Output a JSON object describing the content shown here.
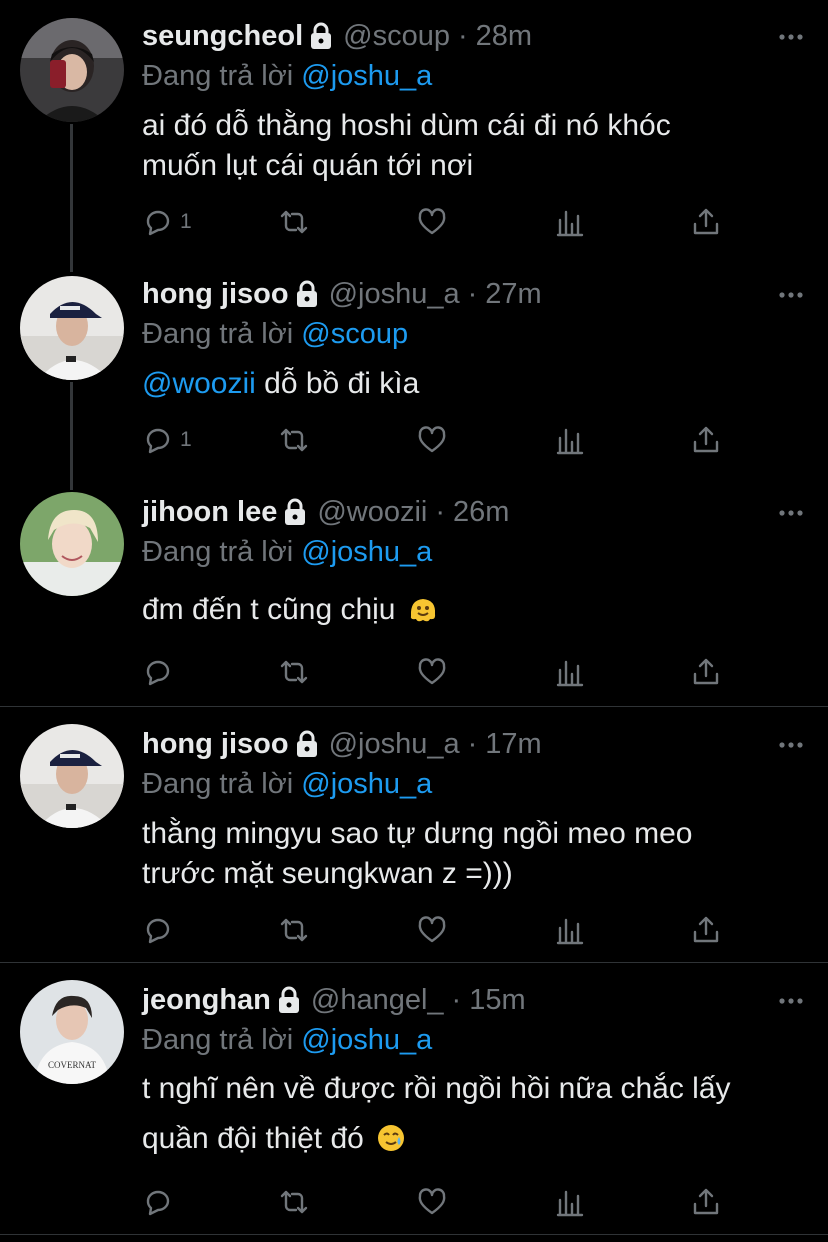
{
  "reply_prefix": "Đang trả lời",
  "colors": {
    "background": "#000000",
    "text": "#e7e9ea",
    "muted": "#71767b",
    "link": "#1d9bf0",
    "divider": "#2f3336"
  },
  "tweets": [
    {
      "display_name": "seungcheol",
      "handle": "@scoup",
      "time": "28m",
      "reply_to": "@joshu_a",
      "body_line1": "ai đó dỗ thằng hoshi dùm cái đi nó khóc",
      "body_line2": "muốn lụt cái quán tới nơi",
      "reply_count": "1",
      "avatar_icon": "avatar-selfie-mirror"
    },
    {
      "display_name": "hong jisoo",
      "handle": "@joshu_a",
      "time": "27m",
      "reply_to": "@scoup",
      "body_mention": "@woozii",
      "body_text": " dỗ bồ đi kìa",
      "reply_count": "1",
      "avatar_icon": "avatar-cap"
    },
    {
      "display_name": "jihoon lee",
      "handle": "@woozii",
      "time": "26m",
      "reply_to": "@joshu_a",
      "body_text": "đm đến t cũng chịu",
      "body_emoji": "melting-face-emoji",
      "avatar_icon": "avatar-blond"
    },
    {
      "display_name": "hong jisoo",
      "handle": "@joshu_a",
      "time": "17m",
      "reply_to": "@joshu_a",
      "body_line1": "thằng mingyu sao tự dưng ngồi meo meo",
      "body_line2": "trước mặt seungkwan z =)))",
      "avatar_icon": "avatar-cap"
    },
    {
      "display_name": "jeonghan",
      "handle": "@hangel_",
      "time": "15m",
      "reply_to": "@joshu_a",
      "body_line1": "t nghĩ nên về được rồi ngồi hồi nữa chắc lấy",
      "body_line2": "quần đội thiệt đó",
      "body_emoji": "tear-smile-emoji",
      "avatar_icon": "avatar-white-shirt",
      "avatar_shirt_text": "COVERNAT"
    }
  ]
}
